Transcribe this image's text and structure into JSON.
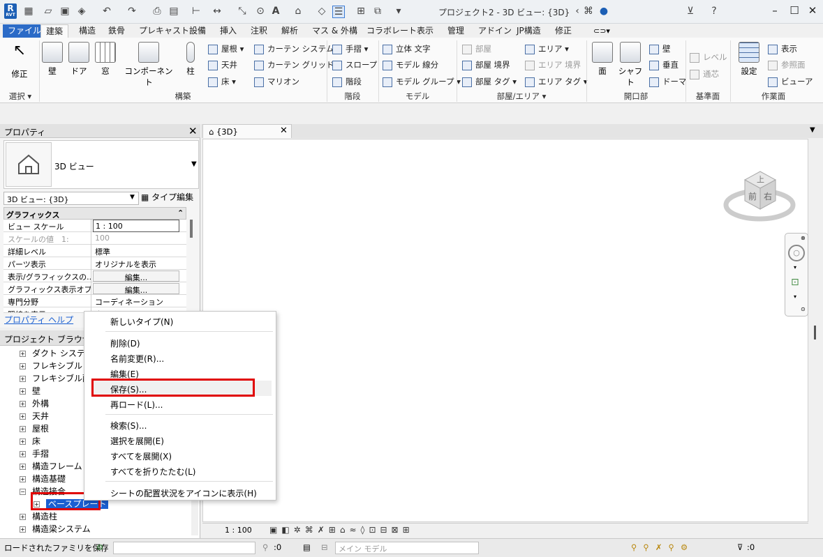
{
  "window": {
    "title": "プロジェクト2 - 3D ビュー: {3D}",
    "logo_text": "R",
    "logo_sub": "RVT"
  },
  "tabs": [
    "ファイル",
    "建築",
    "構造",
    "鉄骨",
    "プレキャスト",
    "設備",
    "挿入",
    "注釈",
    "解析",
    "マス & 外構",
    "コラボレート",
    "表示",
    "管理",
    "アドイン",
    "JP構造",
    "修正"
  ],
  "ribbon": {
    "select": {
      "button": "修正",
      "panel": "選択 ▾"
    },
    "build": {
      "wall": "壁",
      "door": "ドア",
      "window": "窓",
      "component": "コンポーネント",
      "column": "柱",
      "roof": "屋根",
      "ceiling": "天井",
      "floor": "床",
      "curtain_system": "カーテン システム",
      "curtain_grid": "カーテン グリッド",
      "mullion": "マリオン",
      "panel": "構築"
    },
    "circulation": {
      "railing": "手摺",
      "ramp": "スロープ",
      "stair": "階段",
      "panel": "階段"
    },
    "model": {
      "model_text": "立体 文字",
      "model_line": "モデル 線分",
      "model_group": "モデル グループ",
      "panel": "モデル"
    },
    "room_area": {
      "room": "部屋",
      "room_separator": "部屋 境界",
      "room_tag": "部屋 タグ",
      "area": "エリア",
      "area_boundary": "エリア 境界",
      "area_tag": "エリア タグ",
      "panel": "部屋/エリア ▾"
    },
    "opening": {
      "face": "面",
      "shaft": "シャフト",
      "wall": "壁",
      "vertical": "垂直",
      "dormer": "ドーマ",
      "panel": "開口部"
    },
    "datum": {
      "level": "レベル",
      "grid": "通芯",
      "panel": "基準面"
    },
    "workplane": {
      "set": "設定",
      "show": "表示",
      "ref_plane": "参照面",
      "viewer": "ビューア",
      "panel": "作業面"
    }
  },
  "properties": {
    "title": "プロパティ",
    "type_name": "3D ビュー",
    "view_selector": "3D ビュー: {3D}",
    "edit_type": "タイプ編集",
    "group": "グラフィックス",
    "rows": [
      {
        "k": "ビュー スケール",
        "v": "1 : 100"
      },
      {
        "k": "スケールの値　1:",
        "v": "100"
      },
      {
        "k": "詳細レベル",
        "v": "標準"
      },
      {
        "k": "パーツ表示",
        "v": "オリジナルを表示"
      },
      {
        "k": "表示/グラフィックスの...",
        "v": "編集..."
      },
      {
        "k": "グラフィックス表示オプ...",
        "v": "編集..."
      },
      {
        "k": "専門分野",
        "v": "コーディネーション"
      },
      {
        "k": "隠線を表示",
        "v": "専門分野別"
      }
    ],
    "help": "プロパティ ヘルプ"
  },
  "browser": {
    "title": "プロジェクト ブラウザ - プ",
    "items": [
      "ダクト システム",
      "フレキシブル ダ",
      "フレキシブル配",
      "壁",
      "外構",
      "天井",
      "屋根",
      "床",
      "手摺",
      "構造フレーム",
      "構造基礎",
      "構造接合",
      "ベースプレート",
      "構造柱",
      "構造梁システム"
    ]
  },
  "view": {
    "tab": "{3D}",
    "scale": "1 : 100",
    "viewcube_top": "上",
    "viewcube_front": "前",
    "viewcube_right": "右"
  },
  "context_menu": {
    "items": [
      "新しいタイプ(N)",
      "削除(D)",
      "名前変更(R)...",
      "編集(E)",
      "保存(S)...",
      "再ロード(L)...",
      "検索(S)...",
      "選択を展開(E)",
      "すべてを展開(X)",
      "すべてを折りたたむ(L)",
      "シートの配置状況をアイコンに表示(H)"
    ]
  },
  "status": {
    "message": "ロードされたファミリを保存",
    "filter_count": ":0",
    "main_model": "メイン モデル",
    "selection_count": ":0"
  },
  "colors": {
    "accent": "#2b6bc7",
    "highlight": "#e00000",
    "selection": "#1a5fd1"
  }
}
